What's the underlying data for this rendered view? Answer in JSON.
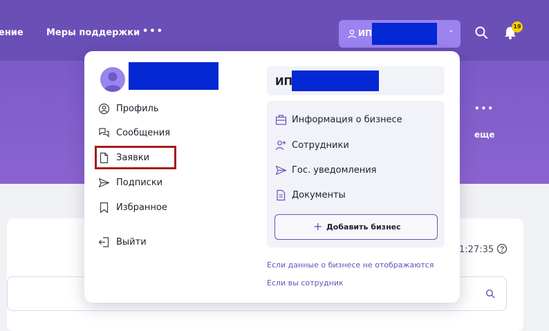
{
  "header": {
    "nav_partial": "ение",
    "nav_support": "Меры поддержки",
    "nav_more": "•••",
    "user_label": "ИП",
    "chevron": "⌃",
    "notifications_count": "19"
  },
  "band": {
    "more_dots": "•••",
    "more_label": "еще"
  },
  "background": {
    "timer": "1:27:35"
  },
  "menu": {
    "items": [
      {
        "label": "Профиль",
        "icon": "profile-icon"
      },
      {
        "label": "Сообщения",
        "icon": "messages-icon"
      },
      {
        "label": "Заявки",
        "icon": "document-icon"
      },
      {
        "label": "Подписки",
        "icon": "send-icon"
      },
      {
        "label": "Избранное",
        "icon": "bookmark-icon"
      }
    ],
    "logout": "Выйти"
  },
  "business": {
    "name_prefix": "ИП",
    "items": [
      {
        "label": "Информация о бизнесе",
        "icon": "briefcase-icon"
      },
      {
        "label": "Сотрудники",
        "icon": "add-user-icon"
      },
      {
        "label": "Гос. уведомления",
        "icon": "send-icon"
      },
      {
        "label": "Документы",
        "icon": "file-icon"
      }
    ],
    "add_button": "Добавить бизнес",
    "plus": "+"
  },
  "links": {
    "not_shown": "Если данные о бизнесе не отображаются",
    "employee": "Если вы сотрудник"
  },
  "colors": {
    "header": "#6a4fb6",
    "accent": "#9b83f0",
    "link": "#6a4fb6",
    "highlight": "#a41a1a",
    "redaction": "#0328d4"
  }
}
